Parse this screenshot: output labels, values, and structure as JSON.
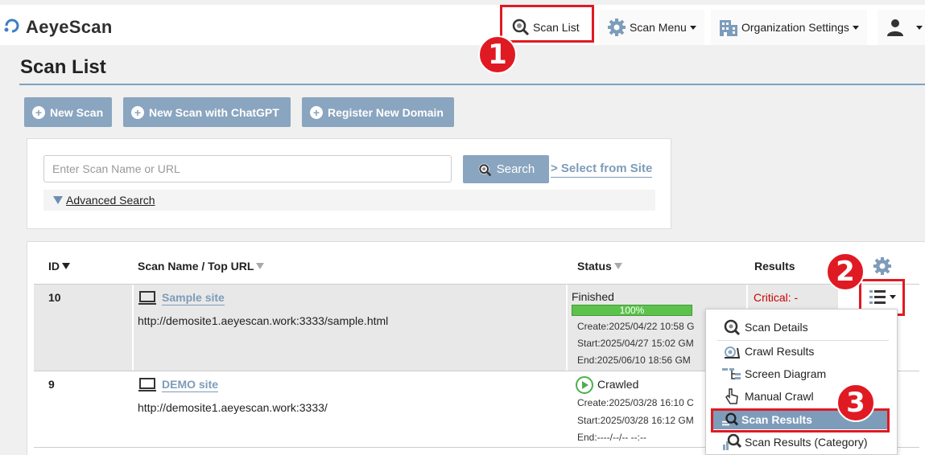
{
  "app": {
    "name": "AeyeScan"
  },
  "nav": {
    "scan_list": "Scan List",
    "scan_menu": "Scan Menu",
    "org_settings": "Organization Settings"
  },
  "page": {
    "title": "Scan List"
  },
  "actions": {
    "new_scan": "New Scan",
    "new_scan_chatgpt": "New Scan with ChatGPT",
    "register_domain": "Register New Domain"
  },
  "search": {
    "placeholder": "Enter Scan Name or URL",
    "value": "",
    "button": "Search",
    "select_from_site": "> Select from Site",
    "advanced": "Advanced Search"
  },
  "table": {
    "headers": {
      "id": "ID",
      "name": "Scan Name / Top URL",
      "status": "Status",
      "results": "Results"
    },
    "rows": [
      {
        "id": "10",
        "name": "Sample site",
        "url": "http://demosite1.aeyescan.work:3333/sample.html",
        "status": "Finished",
        "progress": "100%",
        "progress_value": 1.0,
        "create": "Create:2025/04/22 10:58 G",
        "start": "Start:2025/04/27 15:02 GM",
        "end": "End:2025/06/10 18:56 GM",
        "results": "Critical: -"
      },
      {
        "id": "9",
        "name": "DEMO site",
        "url": "http://demosite1.aeyescan.work:3333/",
        "status": "Crawled",
        "create": "Create:2025/03/28 16:10 C",
        "start": "Start:2025/03/28 16:12 GM",
        "end": "End:----/--/-- --:--"
      }
    ]
  },
  "menu": {
    "items": [
      {
        "label": "Scan Details"
      },
      {
        "label": "Crawl Results"
      },
      {
        "label": "Screen Diagram"
      },
      {
        "label": "Manual Crawl"
      },
      {
        "label": "Scan Results"
      },
      {
        "label": "Scan Results (Category)"
      }
    ]
  },
  "badges": [
    "1",
    "2",
    "3"
  ],
  "colors": {
    "accent": "#8aa5bf",
    "highlight": "#e01a22",
    "critical": "#cc0000",
    "progress": "#5cc24c",
    "link": "#7d9cba"
  }
}
